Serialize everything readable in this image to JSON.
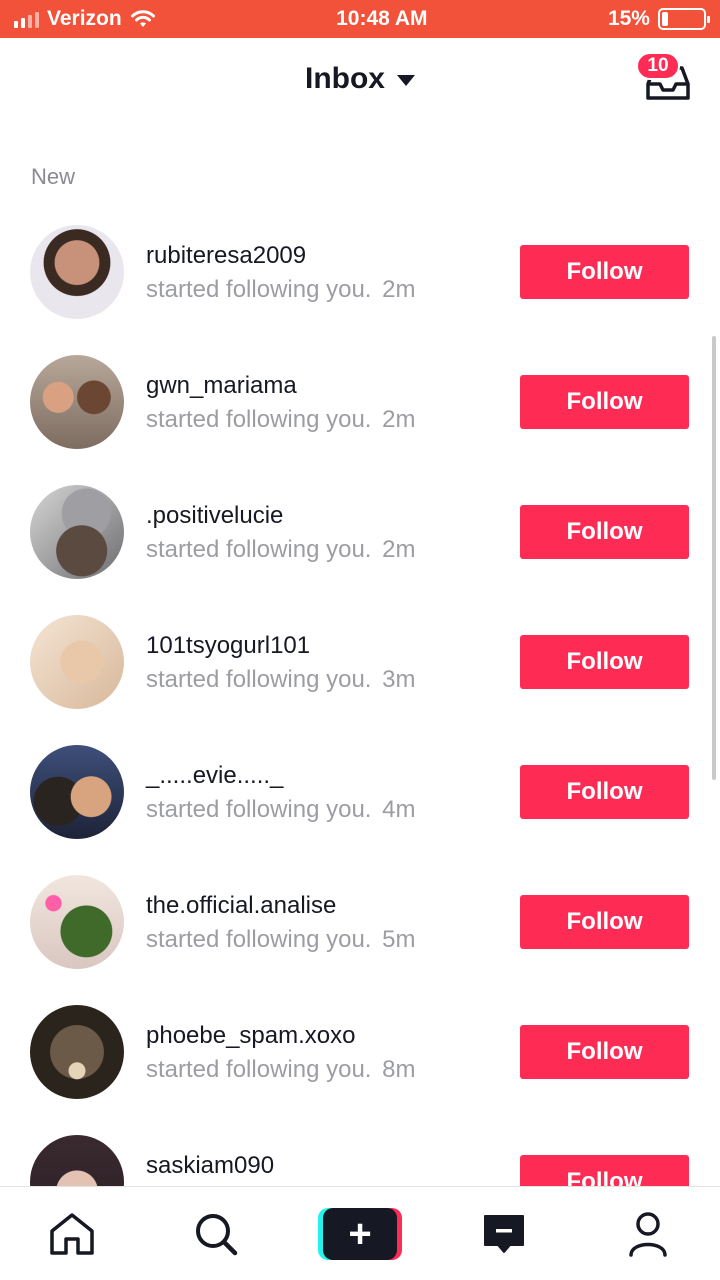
{
  "status_bar": {
    "carrier": "Verizon",
    "time": "10:48 AM",
    "battery_percent": "15%",
    "battery_level": 0.15,
    "signal_bars": 2,
    "icons": [
      "signal-icon",
      "wifi-icon",
      "battery-icon"
    ]
  },
  "header": {
    "title": "Inbox",
    "dropdown_icon": "caret-down-icon",
    "inbox_icon": "inbox-tray-icon",
    "badge_count": "10"
  },
  "section_label": "New",
  "notifications": [
    {
      "username": "rubiteresa2009",
      "action": "started following you.",
      "time": "2m",
      "button": "Follow"
    },
    {
      "username": "gwn_mariama",
      "action": "started following you.",
      "time": "2m",
      "button": "Follow"
    },
    {
      "username": ".positivelucie",
      "action": "started following you.",
      "time": "2m",
      "button": "Follow"
    },
    {
      "username": "101tsyogurl101",
      "action": "started following you.",
      "time": "3m",
      "button": "Follow"
    },
    {
      "username": "_.....evie....._",
      "action": "started following you.",
      "time": "4m",
      "button": "Follow"
    },
    {
      "username": "the.official.analise",
      "action": "started following you.",
      "time": "5m",
      "button": "Follow"
    },
    {
      "username": "phoebe_spam.xoxo",
      "action": "started following you.",
      "time": "8m",
      "button": "Follow"
    },
    {
      "username": "saskiam090",
      "action": "",
      "time": "",
      "button": "Follow"
    }
  ],
  "bottom_nav": {
    "items": [
      "home-icon",
      "search-icon",
      "create-plus-icon",
      "inbox-message-icon",
      "profile-icon"
    ]
  },
  "colors": {
    "status_bar": "#f2513a",
    "accent": "#fe2c55",
    "text_primary": "#161823",
    "text_secondary": "#9c9da3",
    "create_left": "#25f4ee",
    "create_right": "#fe2c55"
  }
}
